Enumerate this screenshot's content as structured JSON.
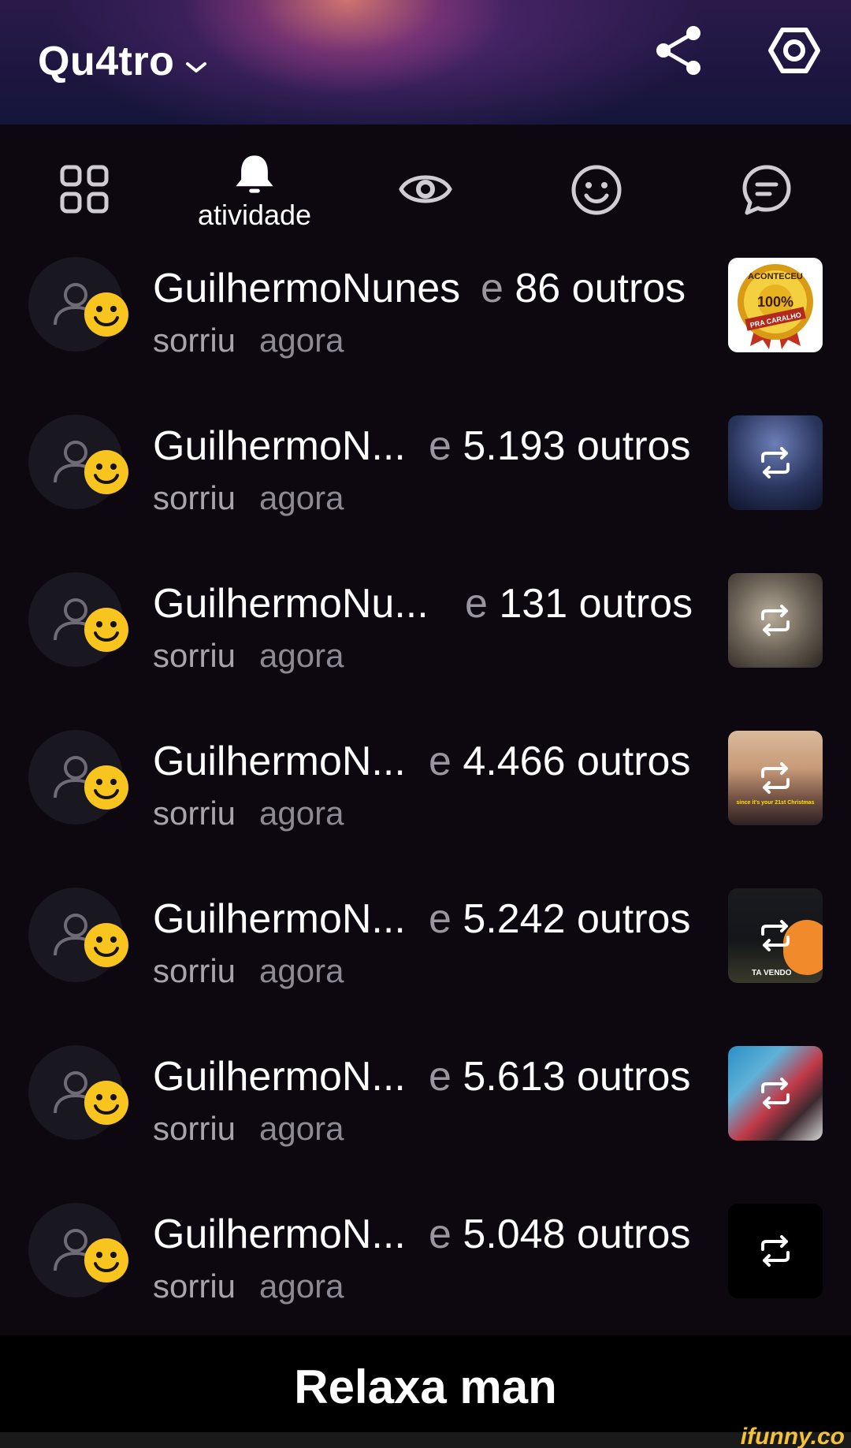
{
  "header": {
    "title": "Qu4tro",
    "share_icon": "share-icon",
    "settings_icon": "gear-icon"
  },
  "tabs": [
    {
      "icon": "grid-icon",
      "label": ""
    },
    {
      "icon": "bell-icon",
      "label": "atividade",
      "active": true
    },
    {
      "icon": "eye-icon",
      "label": ""
    },
    {
      "icon": "smiley-icon",
      "label": ""
    },
    {
      "icon": "chat-bubble-icon",
      "label": ""
    }
  ],
  "notifications": [
    {
      "user": "GuilhermoNunes",
      "others": "e 86 outros",
      "action": "sorriu",
      "time": "agora",
      "thumb": "badge-sticker"
    },
    {
      "user": "GuilhermoN...",
      "others": "e 5.193 outros",
      "action": "sorriu",
      "time": "agora",
      "thumb": "repost"
    },
    {
      "user": "GuilhermoNu...",
      "others": "e 131 outros",
      "action": "sorriu",
      "time": "agora",
      "thumb": "repost"
    },
    {
      "user": "GuilhermoN...",
      "others": "e 4.466 outros",
      "action": "sorriu",
      "time": "agora",
      "thumb": "repost"
    },
    {
      "user": "GuilhermoN...",
      "others": "e 5.242 outros",
      "action": "sorriu",
      "time": "agora",
      "thumb": "repost"
    },
    {
      "user": "GuilhermoN...",
      "others": "e 5.613 outros",
      "action": "sorriu",
      "time": "agora",
      "thumb": "repost"
    },
    {
      "user": "GuilhermoN...",
      "others": "e 5.048 outros",
      "action": "sorriu",
      "time": "agora",
      "thumb": "repost"
    }
  ],
  "badge_text": [
    "ACONTECEU",
    "100%",
    "PRA CARALHO"
  ],
  "thumb_overlays": {
    "row4": "since it's your 21st Christmas",
    "row5": "TA VENDO"
  },
  "caption": "Relaxa man",
  "watermark": "ifunny.co",
  "colors": {
    "background": "#0d0810",
    "smile_yellow": "#f7c51d",
    "muted_text": "#9a96a0"
  }
}
